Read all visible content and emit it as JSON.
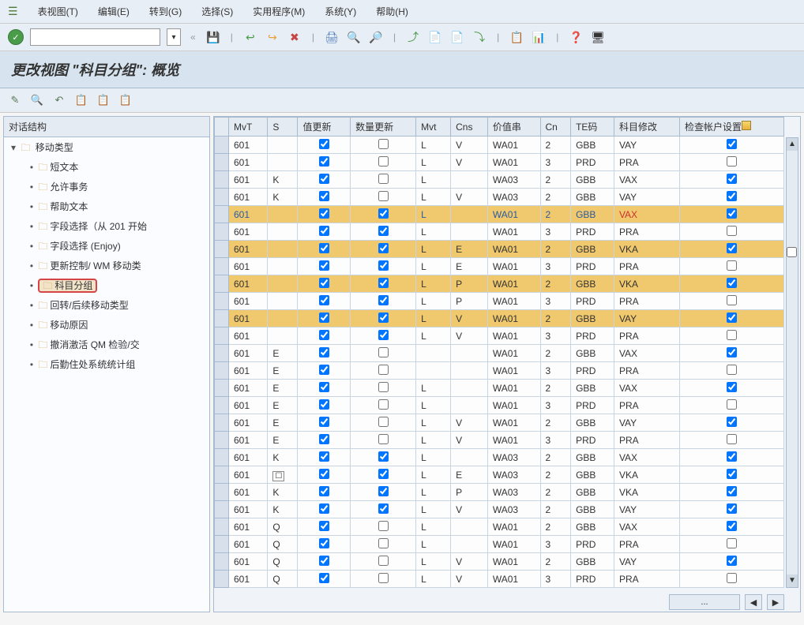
{
  "menu": {
    "items": [
      "表视图(T)",
      "编辑(E)",
      "转到(G)",
      "选择(S)",
      "实用程序(M)",
      "系统(Y)",
      "帮助(H)"
    ]
  },
  "toolbar": {
    "ok_label": "✓",
    "back_chev": "«",
    "icons": [
      "💾",
      "↩",
      "↪",
      "✖",
      "🖨",
      "🔍",
      "🔎",
      "⤴",
      "📄",
      "📄",
      "⤵",
      "📋",
      "📊",
      "❓",
      "🖥"
    ]
  },
  "title": "更改视图 \"科目分组\": 概览",
  "subtoolbar": {
    "icons": [
      "✎",
      "🔍",
      "↶",
      "📋",
      "📋",
      "📋"
    ]
  },
  "tree": {
    "header": "对话结构",
    "root": {
      "label": "移动类型",
      "expanded": true
    },
    "children": [
      {
        "label": "短文本"
      },
      {
        "label": "允许事务"
      },
      {
        "label": "帮助文本"
      },
      {
        "label": "字段选择（从 201 开始"
      },
      {
        "label": "字段选择 (Enjoy)"
      },
      {
        "label": "更新控制/ WM 移动类"
      },
      {
        "label": "科目分组",
        "highlighted": true
      },
      {
        "label": "回转/后续移动类型"
      },
      {
        "label": "移动原因"
      },
      {
        "label": "撤消激活 QM 检验/交"
      },
      {
        "label": "后勤住处系统统计组"
      }
    ]
  },
  "grid": {
    "columns": [
      "MvT",
      "S",
      "值更新",
      "数量更新",
      "Mvt",
      "Cns",
      "价值串",
      "Cn",
      "TE码",
      "科目修改",
      "检查帐户设置"
    ],
    "rows": [
      {
        "mvt": "601",
        "s": "",
        "val": true,
        "qty": false,
        "mvt2": "L",
        "cns": "V",
        "vstr": "WA01",
        "cn": "2",
        "te": "GBB",
        "acct": "VAY",
        "chk": true,
        "gold": false
      },
      {
        "mvt": "601",
        "s": "",
        "val": true,
        "qty": false,
        "mvt2": "L",
        "cns": "V",
        "vstr": "WA01",
        "cn": "3",
        "te": "PRD",
        "acct": "PRA",
        "chk": false,
        "gold": false
      },
      {
        "mvt": "601",
        "s": "K",
        "val": true,
        "qty": false,
        "mvt2": "L",
        "cns": "",
        "vstr": "WA03",
        "cn": "2",
        "te": "GBB",
        "acct": "VAX",
        "chk": true,
        "gold": false
      },
      {
        "mvt": "601",
        "s": "K",
        "val": true,
        "qty": false,
        "mvt2": "L",
        "cns": "V",
        "vstr": "WA03",
        "cn": "2",
        "te": "GBB",
        "acct": "VAY",
        "chk": true,
        "gold": false
      },
      {
        "mvt": "601",
        "s": "",
        "val": true,
        "qty": true,
        "mvt2": "L",
        "cns": "",
        "vstr": "WA01",
        "cn": "2",
        "te": "GBB",
        "acct": "VAX",
        "chk": true,
        "gold": true,
        "red": true,
        "blue": true
      },
      {
        "mvt": "601",
        "s": "",
        "val": true,
        "qty": true,
        "mvt2": "L",
        "cns": "",
        "vstr": "WA01",
        "cn": "3",
        "te": "PRD",
        "acct": "PRA",
        "chk": false,
        "gold": false
      },
      {
        "mvt": "601",
        "s": "",
        "val": true,
        "qty": true,
        "mvt2": "L",
        "cns": "E",
        "vstr": "WA01",
        "cn": "2",
        "te": "GBB",
        "acct": "VKA",
        "chk": true,
        "gold": true
      },
      {
        "mvt": "601",
        "s": "",
        "val": true,
        "qty": true,
        "mvt2": "L",
        "cns": "E",
        "vstr": "WA01",
        "cn": "3",
        "te": "PRD",
        "acct": "PRA",
        "chk": false,
        "gold": false
      },
      {
        "mvt": "601",
        "s": "",
        "val": true,
        "qty": true,
        "mvt2": "L",
        "cns": "P",
        "vstr": "WA01",
        "cn": "2",
        "te": "GBB",
        "acct": "VKA",
        "chk": true,
        "gold": true
      },
      {
        "mvt": "601",
        "s": "",
        "val": true,
        "qty": true,
        "mvt2": "L",
        "cns": "P",
        "vstr": "WA01",
        "cn": "3",
        "te": "PRD",
        "acct": "PRA",
        "chk": false,
        "gold": false
      },
      {
        "mvt": "601",
        "s": "",
        "val": true,
        "qty": true,
        "mvt2": "L",
        "cns": "V",
        "vstr": "WA01",
        "cn": "2",
        "te": "GBB",
        "acct": "VAY",
        "chk": true,
        "gold": true
      },
      {
        "mvt": "601",
        "s": "",
        "val": true,
        "qty": true,
        "mvt2": "L",
        "cns": "V",
        "vstr": "WA01",
        "cn": "3",
        "te": "PRD",
        "acct": "PRA",
        "chk": false,
        "gold": false
      },
      {
        "mvt": "601",
        "s": "E",
        "val": true,
        "qty": false,
        "mvt2": "",
        "cns": "",
        "vstr": "WA01",
        "cn": "2",
        "te": "GBB",
        "acct": "VAX",
        "chk": true,
        "gold": false
      },
      {
        "mvt": "601",
        "s": "E",
        "val": true,
        "qty": false,
        "mvt2": "",
        "cns": "",
        "vstr": "WA01",
        "cn": "3",
        "te": "PRD",
        "acct": "PRA",
        "chk": false,
        "gold": false
      },
      {
        "mvt": "601",
        "s": "E",
        "val": true,
        "qty": false,
        "mvt2": "L",
        "cns": "",
        "vstr": "WA01",
        "cn": "2",
        "te": "GBB",
        "acct": "VAX",
        "chk": true,
        "gold": false
      },
      {
        "mvt": "601",
        "s": "E",
        "val": true,
        "qty": false,
        "mvt2": "L",
        "cns": "",
        "vstr": "WA01",
        "cn": "3",
        "te": "PRD",
        "acct": "PRA",
        "chk": false,
        "gold": false
      },
      {
        "mvt": "601",
        "s": "E",
        "val": true,
        "qty": false,
        "mvt2": "L",
        "cns": "V",
        "vstr": "WA01",
        "cn": "2",
        "te": "GBB",
        "acct": "VAY",
        "chk": true,
        "gold": false
      },
      {
        "mvt": "601",
        "s": "E",
        "val": true,
        "qty": false,
        "mvt2": "L",
        "cns": "V",
        "vstr": "WA01",
        "cn": "3",
        "te": "PRD",
        "acct": "PRA",
        "chk": false,
        "gold": false
      },
      {
        "mvt": "601",
        "s": "K",
        "val": true,
        "qty": true,
        "mvt2": "L",
        "cns": "",
        "vstr": "WA03",
        "cn": "2",
        "te": "GBB",
        "acct": "VAX",
        "chk": true,
        "gold": false
      },
      {
        "mvt": "601",
        "s": "",
        "val": true,
        "qty": true,
        "mvt2": "L",
        "cns": "E",
        "vstr": "WA03",
        "cn": "2",
        "te": "GBB",
        "acct": "VKA",
        "chk": true,
        "gold": false,
        "search": true
      },
      {
        "mvt": "601",
        "s": "K",
        "val": true,
        "qty": true,
        "mvt2": "L",
        "cns": "P",
        "vstr": "WA03",
        "cn": "2",
        "te": "GBB",
        "acct": "VKA",
        "chk": true,
        "gold": false
      },
      {
        "mvt": "601",
        "s": "K",
        "val": true,
        "qty": true,
        "mvt2": "L",
        "cns": "V",
        "vstr": "WA03",
        "cn": "2",
        "te": "GBB",
        "acct": "VAY",
        "chk": true,
        "gold": false
      },
      {
        "mvt": "601",
        "s": "Q",
        "val": true,
        "qty": false,
        "mvt2": "L",
        "cns": "",
        "vstr": "WA01",
        "cn": "2",
        "te": "GBB",
        "acct": "VAX",
        "chk": true,
        "gold": false
      },
      {
        "mvt": "601",
        "s": "Q",
        "val": true,
        "qty": false,
        "mvt2": "L",
        "cns": "",
        "vstr": "WA01",
        "cn": "3",
        "te": "PRD",
        "acct": "PRA",
        "chk": false,
        "gold": false
      },
      {
        "mvt": "601",
        "s": "Q",
        "val": true,
        "qty": false,
        "mvt2": "L",
        "cns": "V",
        "vstr": "WA01",
        "cn": "2",
        "te": "GBB",
        "acct": "VAY",
        "chk": true,
        "gold": false
      },
      {
        "mvt": "601",
        "s": "Q",
        "val": true,
        "qty": false,
        "mvt2": "L",
        "cns": "V",
        "vstr": "WA01",
        "cn": "3",
        "te": "PRD",
        "acct": "PRA",
        "chk": false,
        "gold": false
      }
    ],
    "footer": {
      "pos": "...",
      "left": "◀",
      "right": "▶"
    }
  }
}
